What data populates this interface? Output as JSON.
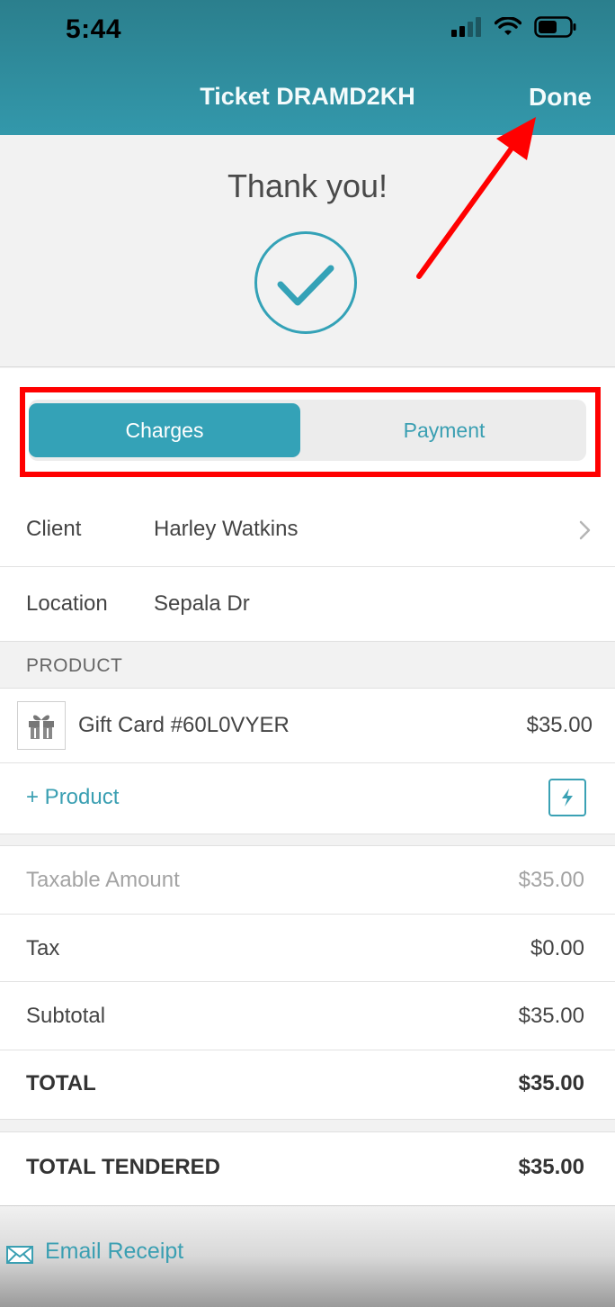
{
  "status_bar": {
    "time": "5:44"
  },
  "nav": {
    "title": "Ticket DRAMD2KH",
    "done_label": "Done"
  },
  "thanks": {
    "message": "Thank you!"
  },
  "segmented": {
    "charges_label": "Charges",
    "payment_label": "Payment",
    "selected": "Charges"
  },
  "client": {
    "label": "Client",
    "value": "Harley Watkins"
  },
  "location": {
    "label": "Location",
    "value": "Sepala Dr"
  },
  "product_section": {
    "header": "PRODUCT"
  },
  "line_items": [
    {
      "name": "Gift Card #60L0VYER",
      "amount": "$35.00",
      "icon": "gift-icon"
    }
  ],
  "add_product": {
    "label": "+ Product",
    "icon": "lightning-icon"
  },
  "totals": {
    "taxable_label": "Taxable Amount",
    "taxable_value": "$35.00",
    "tax_label": "Tax",
    "tax_value": "$0.00",
    "subtotal_label": "Subtotal",
    "subtotal_value": "$35.00",
    "total_label": "TOTAL",
    "total_value": "$35.00"
  },
  "tendered": {
    "label": "TOTAL TENDERED",
    "value": "$35.00"
  },
  "footer": {
    "email_label": "Email Receipt",
    "icon": "envelope-icon"
  },
  "colors": {
    "accent": "#34a2b7",
    "header": "#2e8b9b",
    "annotation": "#ff0000"
  }
}
